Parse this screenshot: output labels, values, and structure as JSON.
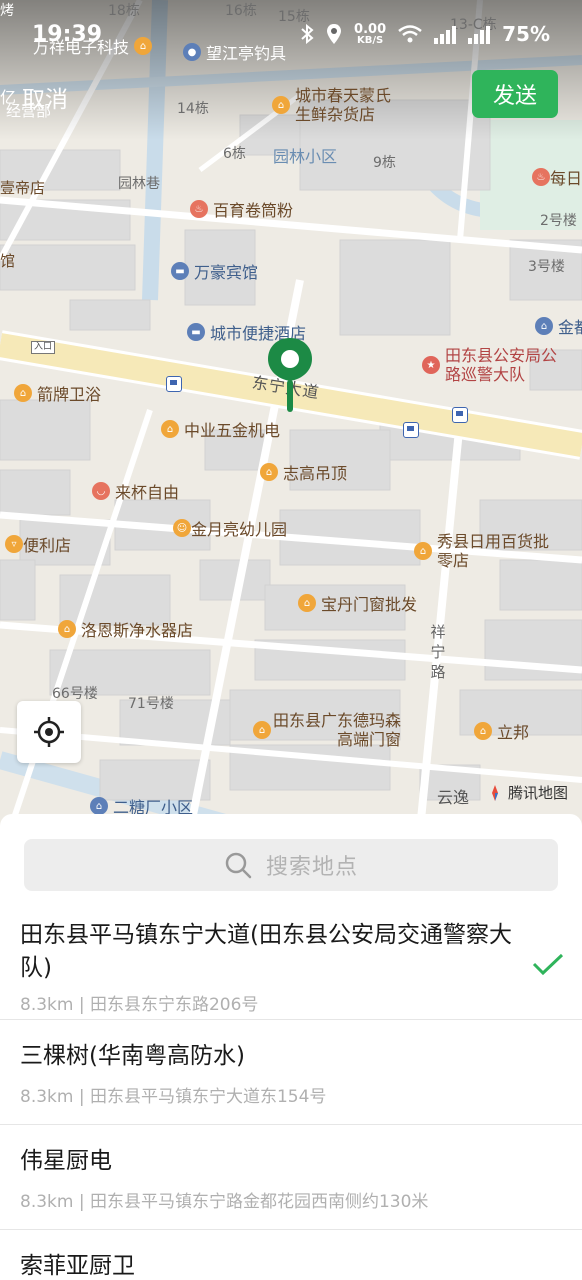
{
  "status_bar": {
    "time": "19:39",
    "net_speed_value": "0.00",
    "net_speed_unit": "KB/S",
    "battery": "75%"
  },
  "header": {
    "cancel_label": "取消",
    "send_label": "发送"
  },
  "map": {
    "communities": [
      "园林小区"
    ],
    "roads": [
      "东宁大道",
      "园林巷",
      "祥宁路"
    ],
    "buildings": [
      "18栋",
      "16栋",
      "15栋",
      "13-C栋",
      "14栋",
      "6栋",
      "9栋",
      "2号楼",
      "3号楼",
      "66号楼",
      "71号楼"
    ],
    "entrance_label": "入口",
    "pois": {
      "p1": "万祥电子科技",
      "p2": "望江亭钓具",
      "p3": "城市春天蒙氏生鲜杂货店",
      "p4": "经营部",
      "p5": "每日",
      "p6": "壹帝店",
      "p7": "百育卷筒粉",
      "p8": "万豪宾馆",
      "p9": "城市便捷酒店",
      "p10": "金都",
      "p11": "田东县公安局公路巡警大队",
      "p12": "箭牌卫浴",
      "p13": "中业五金机电",
      "p14": "志高吊顶",
      "p15": "来杯自由",
      "p16": "金月亮幼儿园",
      "p17": "便利店",
      "p18": "秀县日用百货批零店",
      "p19": "宝丹门窗批发",
      "p20": "洛恩斯净水器店",
      "p21": "田东县广东德玛森高端门窗",
      "p22": "立邦",
      "p23": "二糖厂小区",
      "p24": "云逸",
      "p25": "亿",
      "p26": "馆",
      "p27": "烤"
    },
    "provider_logo": "腾讯地图"
  },
  "search": {
    "placeholder": "搜索地点"
  },
  "results": [
    {
      "name": "田东县平马镇东宁大道(田东县公安局交通警察大队)",
      "address": "8.3km | 田东县东宁东路206号",
      "selected": true
    },
    {
      "name": "三棵树(华南粤高防水)",
      "address": "8.3km | 田东县平马镇东宁大道东154号",
      "selected": false
    },
    {
      "name": "伟星厨电",
      "address": "8.3km | 田东县平马镇东宁路金都花园西南侧约130米",
      "selected": false
    },
    {
      "name": "索菲亚厨卫",
      "address": "",
      "selected": false
    }
  ],
  "colors": {
    "accent_green": "#2fb45b",
    "marker_green": "#1c8a45",
    "map_background": "#eeebe4",
    "main_road": "#f6e9b8"
  },
  "icons": [
    "bluetooth-icon",
    "location-status-icon",
    "wifi-icon",
    "signal-icon",
    "battery-icon",
    "locate-icon",
    "search-icon",
    "check-icon",
    "map-marker-icon",
    "bus-stop-icon"
  ]
}
